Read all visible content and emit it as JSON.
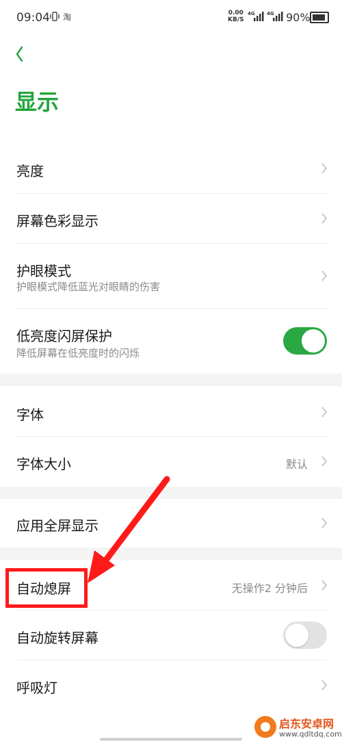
{
  "status_bar": {
    "time": "09:04",
    "net_speed_value": "0.00",
    "net_speed_unit": "KB/S",
    "sig1_label": "4G",
    "sig2_label": "4G",
    "app_icon_text": "淘",
    "battery_text": "90%",
    "battery_level": 0.9
  },
  "page": {
    "title": "显示"
  },
  "settings": {
    "brightness": {
      "label": "亮度"
    },
    "screen_color": {
      "label": "屏幕色彩显示"
    },
    "eye_care": {
      "label": "护眼模式",
      "subtitle": "护眼模式降低蓝光对眼睛的伤害"
    },
    "flicker": {
      "label": "低亮度闪屏保护",
      "subtitle": "降低屏幕在低亮度时的闪烁",
      "enabled": true
    },
    "font": {
      "label": "字体"
    },
    "font_size": {
      "label": "字体大小",
      "value": "默认"
    },
    "fullscreen_apps": {
      "label": "应用全屏显示"
    },
    "auto_lock": {
      "label": "自动熄屏",
      "value": "无操作2 分钟后"
    },
    "auto_rotate": {
      "label": "自动旋转屏幕",
      "enabled": false
    },
    "breathing_light": {
      "label": "呼吸灯"
    }
  },
  "annotation": {
    "color": "#ff1a1a"
  },
  "watermark": {
    "name": "启东安卓网",
    "url": "www.qdltdq.com"
  },
  "colors": {
    "accent": "#21a53a",
    "toggle_on": "#2aa843"
  }
}
